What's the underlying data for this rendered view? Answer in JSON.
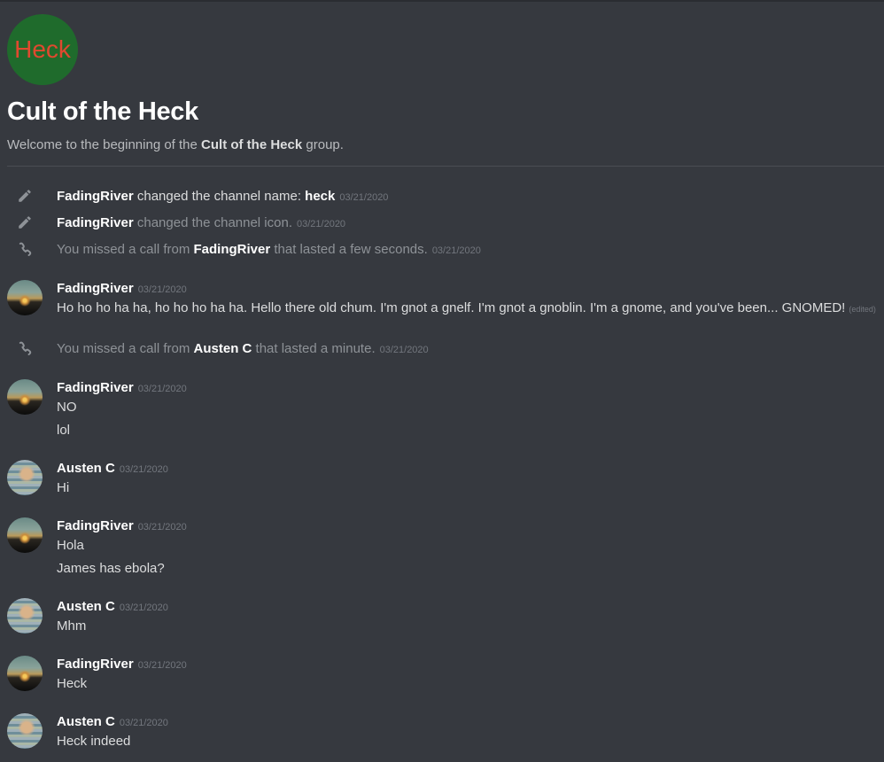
{
  "group": {
    "icon_text": "Heck",
    "title": "Cult of the Heck",
    "welcome_prefix": "Welcome to the beginning of the ",
    "welcome_name": "Cult of the Heck",
    "welcome_suffix": " group."
  },
  "system_messages": [
    {
      "icon": "pencil-icon",
      "user": "FadingRiver",
      "text": " changed the channel name: ",
      "value": "heck",
      "timestamp": "03/21/2020"
    },
    {
      "icon": "pencil-icon",
      "user": "FadingRiver",
      "text": " changed the channel icon.",
      "timestamp": "03/21/2020"
    },
    {
      "icon": "phone-icon",
      "prefix": "You missed a call from ",
      "user": "FadingRiver",
      "suffix": " that lasted a few seconds.",
      "timestamp": "03/21/2020"
    },
    {
      "icon": "phone-icon",
      "prefix": "You missed a call from ",
      "user": "Austen C",
      "suffix": " that lasted a minute.",
      "timestamp": "03/21/2020"
    }
  ],
  "messages": [
    {
      "author": "FadingRiver",
      "timestamp": "03/21/2020",
      "lines": [
        "Ho ho ho ha ha, ho ho ho ha ha. Hello there old chum. I'm gnot a gnelf. I'm gnot a gnoblin.  I'm a gnome, and you've been... GNOMED!"
      ],
      "edited": "(edited)"
    },
    {
      "author": "FadingRiver",
      "timestamp": "03/21/2020",
      "lines": [
        "NO",
        "lol"
      ]
    },
    {
      "author": "Austen C",
      "timestamp": "03/21/2020",
      "lines": [
        "Hi"
      ]
    },
    {
      "author": "FadingRiver",
      "timestamp": "03/21/2020",
      "lines": [
        "Hola",
        "James has ebola?"
      ]
    },
    {
      "author": "Austen C",
      "timestamp": "03/21/2020",
      "lines": [
        "Mhm"
      ]
    },
    {
      "author": "FadingRiver",
      "timestamp": "03/21/2020",
      "lines": [
        "Heck"
      ]
    },
    {
      "author": "Austen C",
      "timestamp": "03/21/2020",
      "lines": [
        "Heck indeed"
      ]
    }
  ]
}
